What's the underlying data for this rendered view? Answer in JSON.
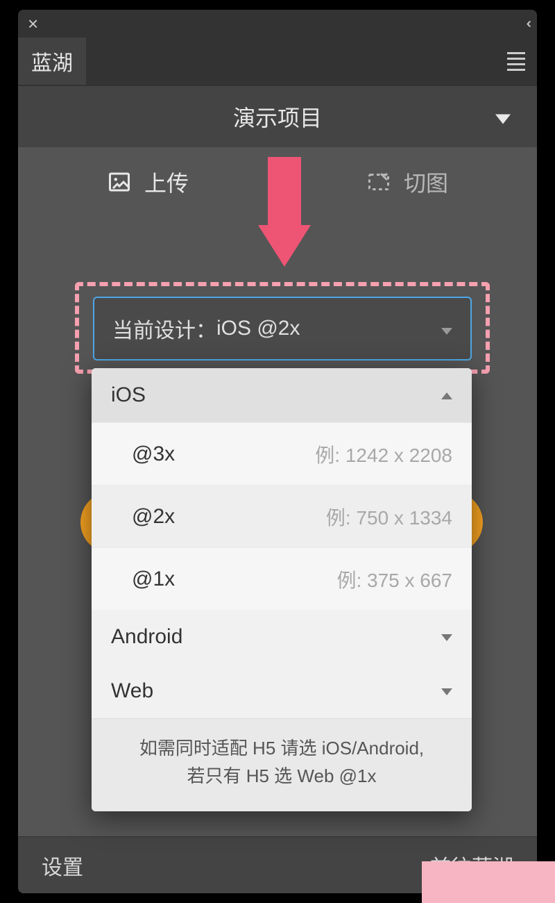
{
  "titlebar": {
    "close_glyph": "×",
    "collapse_glyph": "‹‹"
  },
  "tab": {
    "label": "蓝湖"
  },
  "project": {
    "label": "演示项目"
  },
  "actions": {
    "upload": "上传",
    "slice": "切图"
  },
  "design_field": {
    "prefix": "当前设计：",
    "value": "iOS @2x"
  },
  "dropdown": {
    "sections": [
      {
        "name": "iOS",
        "expanded": true,
        "items": [
          {
            "label": "@3x",
            "example": "例: 1242 x 2208"
          },
          {
            "label": "@2x",
            "example": "例: 750 x 1334"
          },
          {
            "label": "@1x",
            "example": "例: 375 x 667"
          }
        ]
      },
      {
        "name": "Android",
        "expanded": false
      },
      {
        "name": "Web",
        "expanded": false
      }
    ],
    "hint_line1": "如需同时适配 H5 请选 iOS/Android,",
    "hint_line2": "若只有 H5 选 Web @1x"
  },
  "footer": {
    "settings": "设置",
    "goto": "前往蓝湖"
  }
}
